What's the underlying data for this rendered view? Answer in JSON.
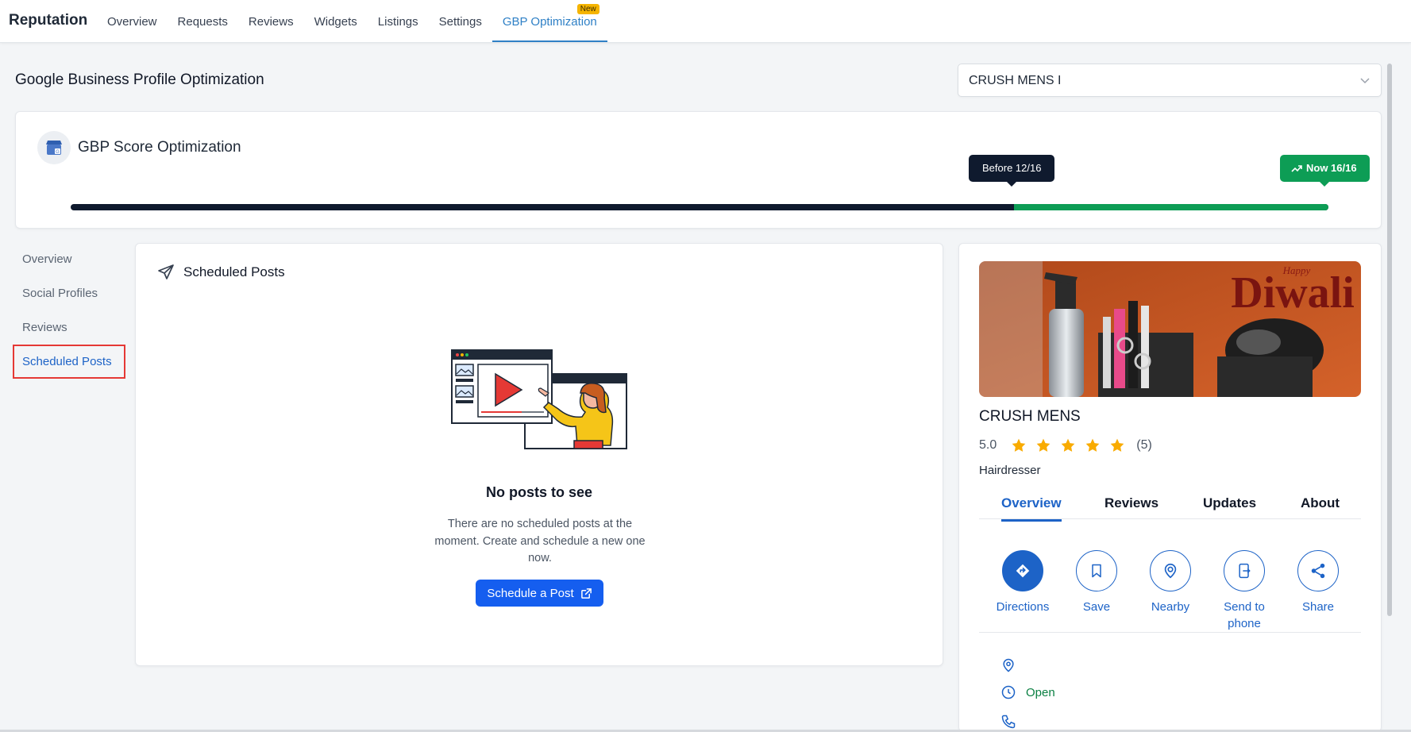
{
  "app": {
    "title": "Reputation"
  },
  "nav": {
    "tabs": [
      {
        "label": "Overview"
      },
      {
        "label": "Requests"
      },
      {
        "label": "Reviews"
      },
      {
        "label": "Widgets"
      },
      {
        "label": "Listings"
      },
      {
        "label": "Settings"
      },
      {
        "label": "GBP Optimization",
        "badge": "New",
        "active": true
      }
    ]
  },
  "page": {
    "title": "Google Business Profile Optimization"
  },
  "location_select": {
    "value": "CRUSH MENS I"
  },
  "score": {
    "title": "GBP Score Optimization",
    "before_label": "Before 12/16",
    "now_label": "Now 16/16",
    "before_value": 12,
    "now_value": 16,
    "max": 16,
    "colors": {
      "before": "#0f1a2e",
      "gain": "#0d9d55"
    }
  },
  "side_menu": {
    "items": [
      {
        "label": "Overview"
      },
      {
        "label": "Social Profiles"
      },
      {
        "label": "Reviews"
      },
      {
        "label": "Scheduled Posts",
        "active": true
      }
    ]
  },
  "posts": {
    "title": "Scheduled Posts",
    "empty_title": "No posts to see",
    "empty_description": "There are no scheduled posts at the moment. Create and schedule a new one now.",
    "button_label": "Schedule a Post"
  },
  "profile": {
    "cover_text": "Diwali",
    "cover_small_text": "Happy",
    "name": "CRUSH MENS",
    "rating": "5.0",
    "stars": 5,
    "review_count": "(5)",
    "category": "Hairdresser",
    "tabs": [
      {
        "label": "Overview",
        "active": true
      },
      {
        "label": "Reviews"
      },
      {
        "label": "Updates"
      },
      {
        "label": "About"
      }
    ],
    "actions": [
      {
        "label": "Directions",
        "icon": "directions-icon"
      },
      {
        "label": "Save",
        "icon": "bookmark-icon"
      },
      {
        "label": "Nearby",
        "icon": "nearby-icon"
      },
      {
        "label": "Send to phone",
        "icon": "send-to-phone-icon"
      },
      {
        "label": "Share",
        "icon": "share-icon"
      }
    ],
    "status": "Open"
  },
  "colors": {
    "accent": "#1d63c7",
    "nav_active": "#2f80c6",
    "success": "#0d9d55",
    "star": "#f9ab00"
  }
}
